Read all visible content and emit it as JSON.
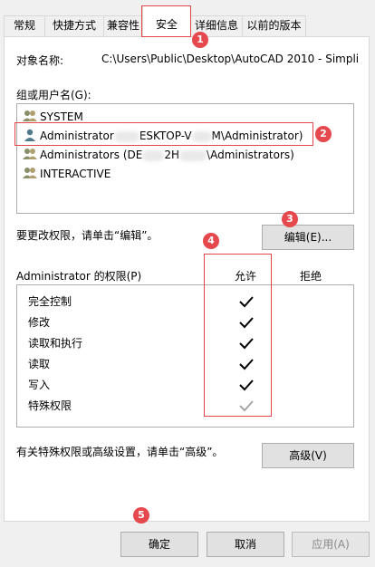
{
  "tabs": [
    {
      "label": "常规"
    },
    {
      "label": "快捷方式"
    },
    {
      "label": "兼容性"
    },
    {
      "label": "安全"
    },
    {
      "label": "详细信息"
    },
    {
      "label": "以前的版本"
    }
  ],
  "object": {
    "label": "对象名称:",
    "value": "C:\\Users\\Public\\Desktop\\AutoCAD 2010 - Simpli"
  },
  "groups": {
    "label": "组或用户名(G):",
    "items": [
      {
        "label": "SYSTEM"
      },
      {
        "label_prefix": "Administrator",
        "label_suffix": "ESKTOP-V",
        "label_tail": "M\\Administrator)"
      },
      {
        "label_prefix": "Administrators (DE",
        "label_suffix": "2H",
        "label_tail": "\\Administrators)"
      },
      {
        "label": "INTERACTIVE"
      }
    ]
  },
  "edit": {
    "hint": "要更改权限，请单击“编辑”。",
    "button": "编辑(E)..."
  },
  "permissions": {
    "title": "Administrator 的权限(P)",
    "allow_header": "允许",
    "deny_header": "拒绝",
    "rows": [
      {
        "label": "完全控制",
        "allow": true,
        "disabled": false
      },
      {
        "label": "修改",
        "allow": true,
        "disabled": false
      },
      {
        "label": "读取和执行",
        "allow": true,
        "disabled": false
      },
      {
        "label": "读取",
        "allow": true,
        "disabled": false
      },
      {
        "label": "写入",
        "allow": true,
        "disabled": false
      },
      {
        "label": "特殊权限",
        "allow": true,
        "disabled": true
      }
    ]
  },
  "advanced": {
    "hint": "有关特殊权限或高级设置，请单击“高级”。",
    "button": "高级(V)"
  },
  "footer": {
    "ok": "确定",
    "cancel": "取消",
    "apply": "应用(A)"
  },
  "markers": [
    "1",
    "2",
    "3",
    "4",
    "5"
  ],
  "colors": {
    "annotation": "#e5484d",
    "check": "#000000",
    "check_disabled": "#a6a6a6"
  }
}
